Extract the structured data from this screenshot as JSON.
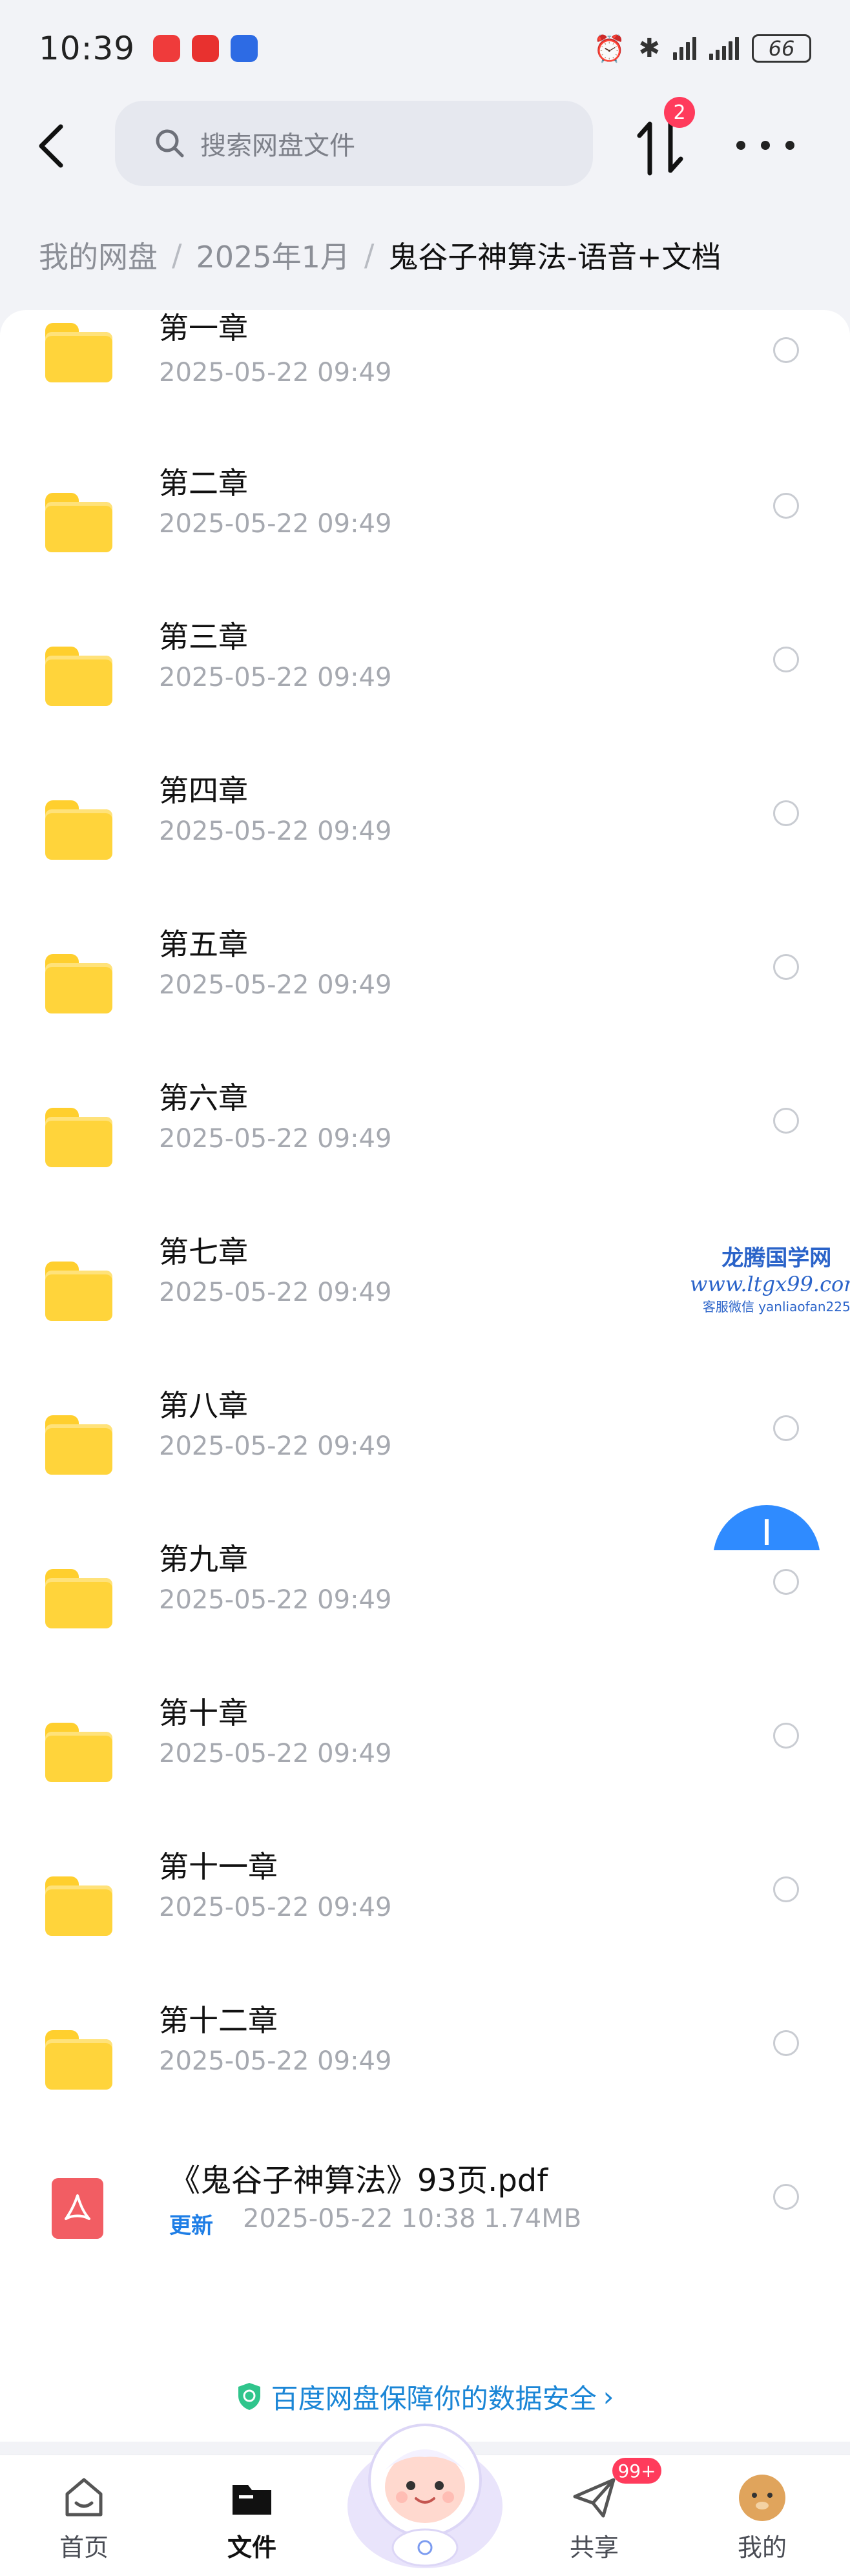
{
  "status_bar": {
    "time": "10:39",
    "battery": "66"
  },
  "header": {
    "search_placeholder": "搜索网盘文件",
    "transfer_badge": "2"
  },
  "breadcrumb": [
    "我的网盘",
    "2025年1月",
    "鬼谷子神算法-语音+文档"
  ],
  "folders": [
    {
      "name": "第一章",
      "date": "2025-05-22  09:49"
    },
    {
      "name": "第二章",
      "date": "2025-05-22  09:49"
    },
    {
      "name": "第三章",
      "date": "2025-05-22  09:49"
    },
    {
      "name": "第四章",
      "date": "2025-05-22  09:49"
    },
    {
      "name": "第五章",
      "date": "2025-05-22  09:49"
    },
    {
      "name": "第六章",
      "date": "2025-05-22  09:49"
    },
    {
      "name": "第七章",
      "date": "2025-05-22  09:49"
    },
    {
      "name": "第八章",
      "date": "2025-05-22  09:49"
    },
    {
      "name": "第九章",
      "date": "2025-05-22  09:49"
    },
    {
      "name": "第十章",
      "date": "2025-05-22  09:49"
    },
    {
      "name": "第十一章",
      "date": "2025-05-22  09:49"
    },
    {
      "name": "第十二章",
      "date": "2025-05-22  09:49"
    }
  ],
  "pdf_file": {
    "name": "《鬼谷子神算法》93页.pdf",
    "tag": "更新",
    "meta": "2025-05-22  10:38  1.74MB"
  },
  "watermark": {
    "line1": "龙腾国学网",
    "line2": "www.ltgx99.com",
    "line3": "客服微信 yanliaofan225"
  },
  "security_banner": "百度网盘保障你的数据安全",
  "bottom_nav": [
    {
      "label": "首页"
    },
    {
      "label": "文件"
    },
    {
      "label": "共享",
      "badge": "99+"
    },
    {
      "label": "我的"
    }
  ],
  "colors": {
    "accent": "#1b86d6",
    "folder": "#ffd43b",
    "badge": "#ff3b5c",
    "pdf": "#f25d63"
  }
}
